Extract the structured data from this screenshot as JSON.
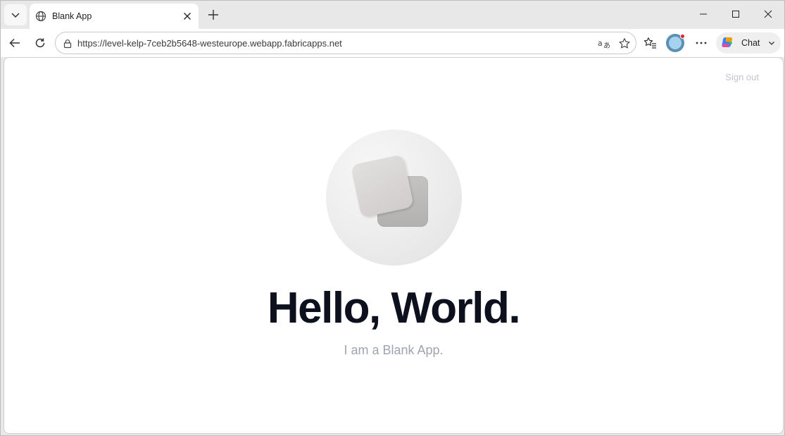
{
  "browser": {
    "tab": {
      "title": "Blank App",
      "favicon": "globe-icon"
    },
    "address": {
      "url": "https://level-kelp-7ceb2b5648-westeurope.webapp.fabricapps.net"
    },
    "chat": {
      "label": "Chat"
    }
  },
  "page": {
    "sign_out": "Sign out",
    "title": "Hello, World.",
    "subtitle": "I am a Blank App."
  },
  "colors": {
    "title": "#0c111d",
    "subtitle": "#9ea4b0",
    "sign_out": "#c1c5cf"
  }
}
